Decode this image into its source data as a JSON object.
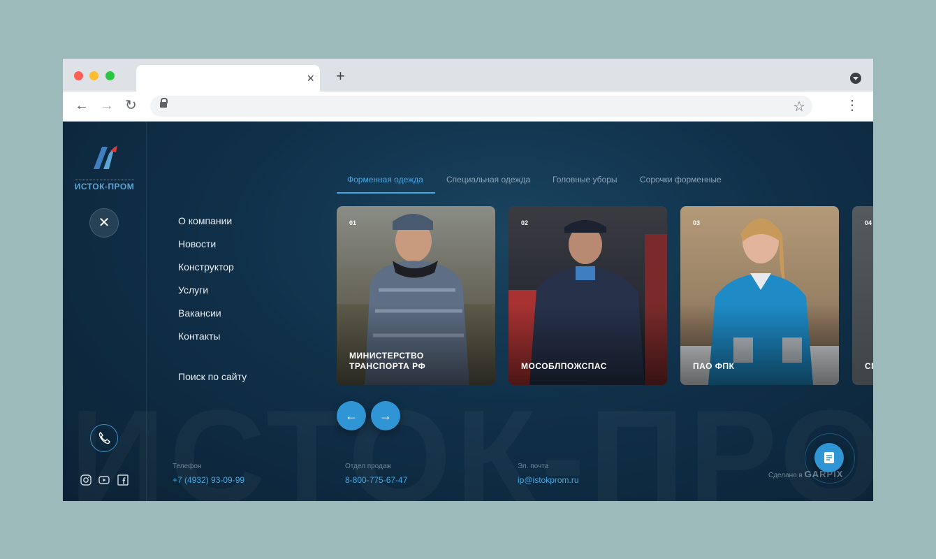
{
  "browser": {
    "tab_close": "×",
    "new_tab": "+",
    "back": "←",
    "forward": "→",
    "reload": "↻",
    "star": "☆",
    "menu": "⋮"
  },
  "logo": {
    "text": "ИСТОК-ПРОМ",
    "colors": {
      "mark": "#3f7fbf",
      "accent": "#e53935"
    }
  },
  "menu_close": "✕",
  "nav": {
    "items": [
      {
        "label": "О компании"
      },
      {
        "label": "Новости"
      },
      {
        "label": "Конструктор"
      },
      {
        "label": "Услуги"
      },
      {
        "label": "Вакансии"
      },
      {
        "label": "Контакты"
      }
    ],
    "search_label": "Поиск по сайту"
  },
  "tabs": [
    {
      "label": "Форменная одежда",
      "active": true
    },
    {
      "label": "Специальная одежда",
      "active": false
    },
    {
      "label": "Головные уборы",
      "active": false
    },
    {
      "label": "Сорочки форменные",
      "active": false
    }
  ],
  "cards": [
    {
      "num": "01",
      "title": "МИНИСТЕРСТВО ТРАНСПОРТА РФ"
    },
    {
      "num": "02",
      "title": "МОСОБЛПОЖСПАС"
    },
    {
      "num": "03",
      "title": "ПАО ФПК"
    },
    {
      "num": "04",
      "title": "СП"
    }
  ],
  "slider": {
    "prev": "←",
    "next": "→"
  },
  "watermark": "ИСТОК-ПРОМ",
  "footer": {
    "phone_label": "Телефон",
    "phone_value": "+7 (4932) 93-09-99",
    "sales_label": "Отдел продаж",
    "sales_value": "8-800-775-67-47",
    "email_label": "Эл. почта",
    "email_value": "ip@istokprom.ru",
    "made_in": "Сделано в",
    "studio": "GARPIX"
  },
  "colors": {
    "accent": "#43a8e3",
    "button": "#2f95d4",
    "background": "#103049"
  }
}
